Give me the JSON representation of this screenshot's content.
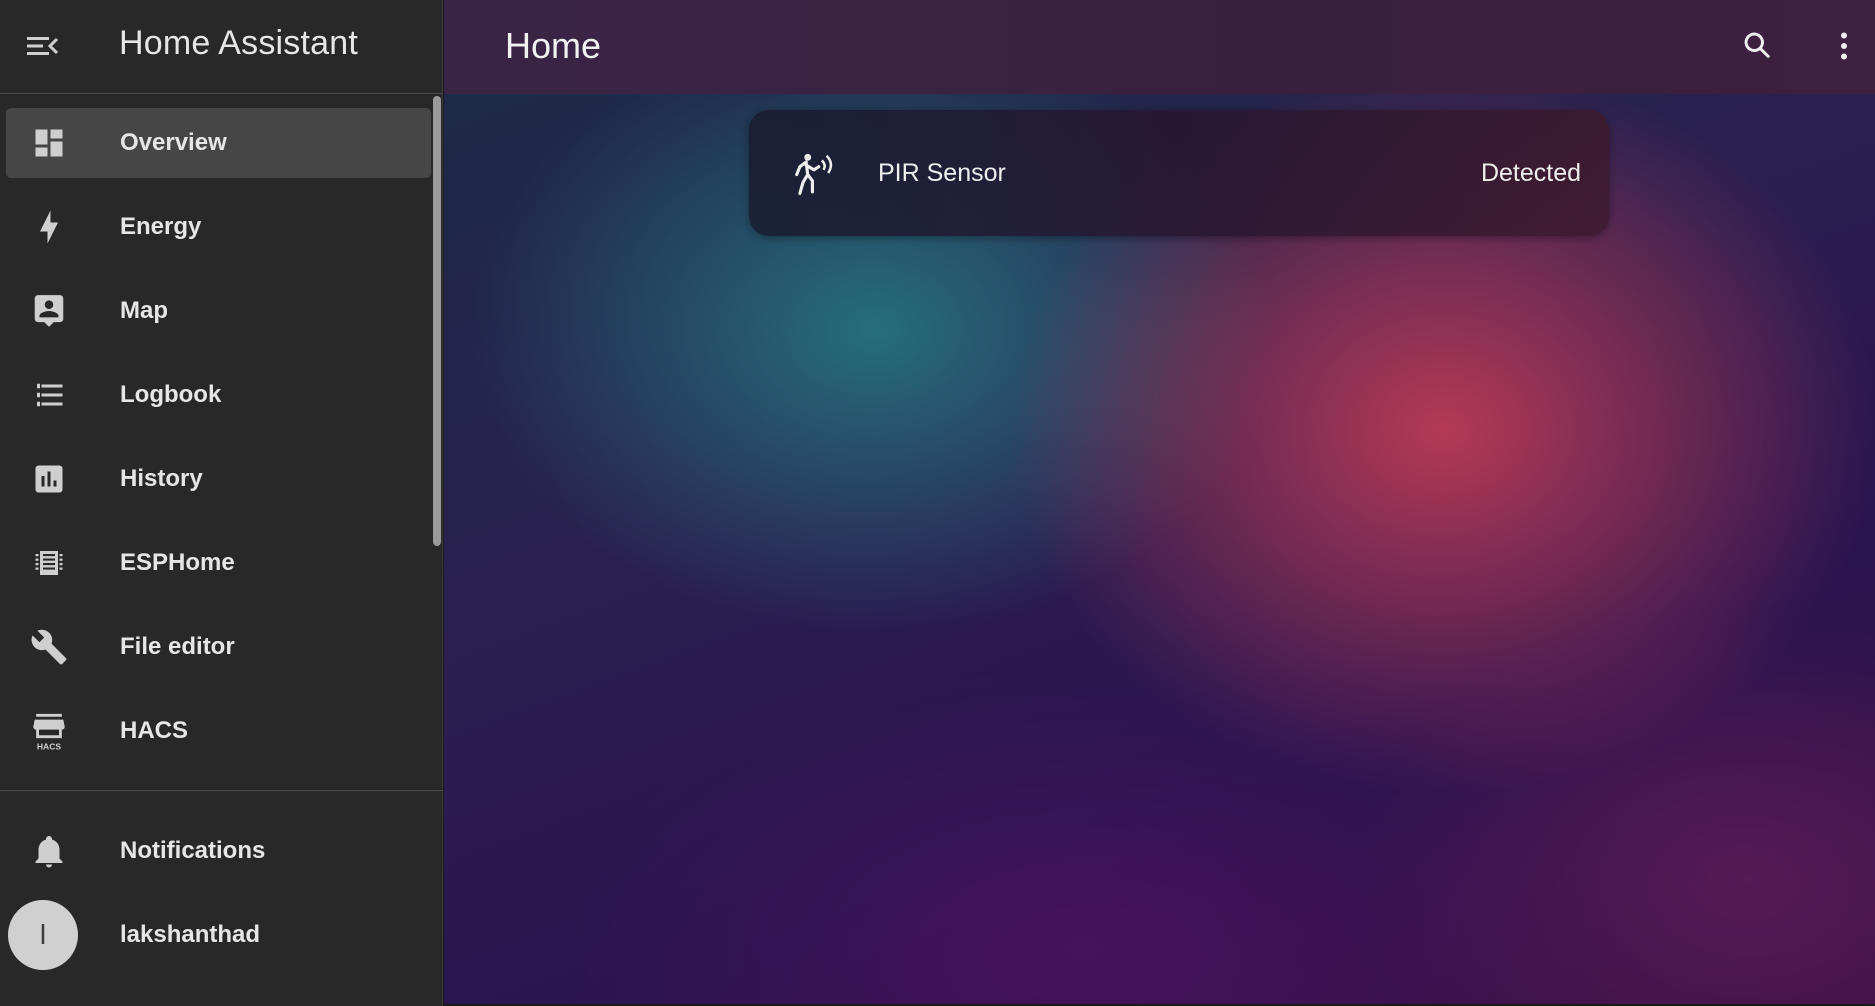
{
  "app": {
    "title": "Home Assistant"
  },
  "sidebar": {
    "items": [
      {
        "label": "Overview",
        "icon": "view-dashboard-icon",
        "active": true
      },
      {
        "label": "Energy",
        "icon": "lightning-bolt-icon"
      },
      {
        "label": "Map",
        "icon": "account-box-icon"
      },
      {
        "label": "Logbook",
        "icon": "format-list-bulleted-icon"
      },
      {
        "label": "History",
        "icon": "chart-box-icon"
      },
      {
        "label": "ESPHome",
        "icon": "chip-icon"
      },
      {
        "label": "File editor",
        "icon": "wrench-icon"
      },
      {
        "label": "HACS",
        "icon": "hacs-store-icon"
      }
    ],
    "notifications_label": "Notifications",
    "user": {
      "name": "lakshanthad",
      "initial": "l"
    }
  },
  "header": {
    "title": "Home"
  },
  "cards": [
    {
      "name": "PIR Sensor",
      "state": "Detected",
      "icon": "motion-sensor-icon"
    }
  ],
  "colors": {
    "sidebar_bg": "#282828",
    "active_item_bg": "#464646",
    "text": "#e1e1e1"
  }
}
